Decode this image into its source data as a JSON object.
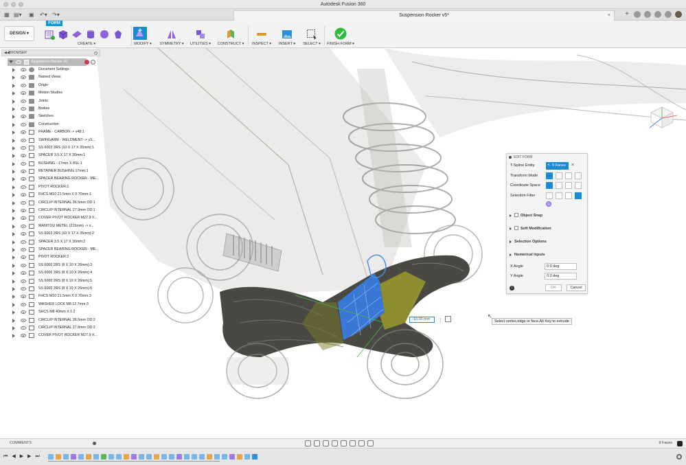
{
  "app": {
    "title": "Autodesk Fusion 360",
    "document_tab": "Suspension Rocker v5*"
  },
  "toolbar": {
    "workspace": "DESIGN ▾",
    "active_tab": "FORM",
    "groups": [
      {
        "key": "create",
        "label": "CREATE ▾"
      },
      {
        "key": "modify",
        "label": "MODIFY ▾"
      },
      {
        "key": "symmetry",
        "label": "SYMMETRY ▾"
      },
      {
        "key": "utilities",
        "label": "UTILITIES ▾"
      },
      {
        "key": "construct",
        "label": "CONSTRUCT ▾"
      },
      {
        "key": "inspect",
        "label": "INSPECT ▾"
      },
      {
        "key": "insert",
        "label": "INSERT ▾"
      },
      {
        "key": "select",
        "label": "SELECT ▾"
      },
      {
        "key": "finish_form",
        "label": "FINISH FORM ▾"
      }
    ]
  },
  "browser": {
    "header": "BROWSER",
    "root": "Suspension Rocker v5",
    "items": [
      {
        "label": "Document Settings",
        "icon": "gear"
      },
      {
        "label": "Named Views",
        "icon": "folder"
      },
      {
        "label": "Origin",
        "icon": "folder"
      },
      {
        "label": "Motion Studies",
        "icon": "folder"
      },
      {
        "label": "Joints",
        "icon": "folder"
      },
      {
        "label": "Bodies",
        "icon": "folder"
      },
      {
        "label": "Sketches",
        "icon": "folder"
      },
      {
        "label": "Construction",
        "icon": "folder"
      },
      {
        "label": "FRAME - CARBON -> v48:1",
        "icon": "comp"
      },
      {
        "label": "SWINGARM - WELDMENT -> v3...",
        "icon": "comp"
      },
      {
        "label": "SS 6003 2RS (10 X 17 X 35mm):1",
        "icon": "comp"
      },
      {
        "label": "SPACER 3.5 X 17 X 30mm:1",
        "icon": "comp"
      },
      {
        "label": "BUSHING - 17mm X 8SL:1",
        "icon": "comp"
      },
      {
        "label": "RETAINER BUSHING 17mm:1",
        "icon": "comp"
      },
      {
        "label": "SPACER BEARING ROCKER - ME...",
        "icon": "comp"
      },
      {
        "label": "PIVOT ROCKER:1",
        "icon": "comp"
      },
      {
        "label": "FHCS M10 21.5mm X 0.70mm:1",
        "icon": "comp"
      },
      {
        "label": "CIRCLIP INTERNAL 36.5mm OD:1",
        "icon": "comp"
      },
      {
        "label": "CIRCLIP INTERNAL 27.9mm OD:1",
        "icon": "comp"
      },
      {
        "label": "COVER PIVOT ROCKER M27.9 X...",
        "icon": "comp"
      },
      {
        "label": "MANITOU METEL (215mm) -> v...",
        "icon": "comp"
      },
      {
        "label": "SS 6003 2RS (10 X 17 X 35mm):2",
        "icon": "comp"
      },
      {
        "label": "SPACER 3.5 X 17 X 30mm:2",
        "icon": "comp"
      },
      {
        "label": "SPACER BEARING ROCKER - ME...",
        "icon": "comp"
      },
      {
        "label": "PIVOT ROCKER:2",
        "icon": "comp"
      },
      {
        "label": "SS 6000 2RS (8 X 10 X 26mm):3",
        "icon": "comp"
      },
      {
        "label": "SS 6000 2RS (8 X 10 X 26mm):4",
        "icon": "comp"
      },
      {
        "label": "SS 6000 2RS (8 X 10 X 26mm):5",
        "icon": "comp"
      },
      {
        "label": "SS 6000 2RS (8 X 10 X 26mm):6",
        "icon": "comp"
      },
      {
        "label": "FHCS M10 21.5mm X 0.70mm:3",
        "icon": "comp"
      },
      {
        "label": "WASHER LOCK M8 12.7mm:3",
        "icon": "comp"
      },
      {
        "label": "SHCS M8 40mm X 1:2",
        "icon": "comp"
      },
      {
        "label": "CIRCLIP INTERNAL 36.5mm OD:2",
        "icon": "comp"
      },
      {
        "label": "CIRCLIP INTERNAL 27.9mm OD:2",
        "icon": "comp"
      },
      {
        "label": "COVER PIVOT ROCKER M27.9 X...",
        "icon": "comp"
      }
    ]
  },
  "edit_form": {
    "header": "EDIT FORM",
    "tspline_entity_label": "T-Spline Entity",
    "tspline_entity_value": "9 Faces",
    "transform_mode_label": "Transform Mode",
    "coordinate_space_label": "Coordinate Space",
    "selection_filter_label": "Selection Filter",
    "sections": [
      "Object Snap",
      "Soft Modification",
      "Selection Options",
      "Numerical Inputs"
    ],
    "x_angle_label": "X Angle",
    "x_angle_value": "0.0 deg",
    "y_angle_label": "Y Angle",
    "y_angle_value": "0.0 deg",
    "ok_label": "OK",
    "cancel_label": "Cancel"
  },
  "viewport": {
    "dimension_value": "-10.00 mm",
    "tooltip": "Select vertex,edge or face.Alt Key to extrude",
    "accent": "#1b8ad3",
    "selection_color": "#3a78d6",
    "highlight_color": "#9b9a2a"
  },
  "footer": {
    "comments_label": "COMMENTS",
    "selection_status": "9 Faces"
  }
}
